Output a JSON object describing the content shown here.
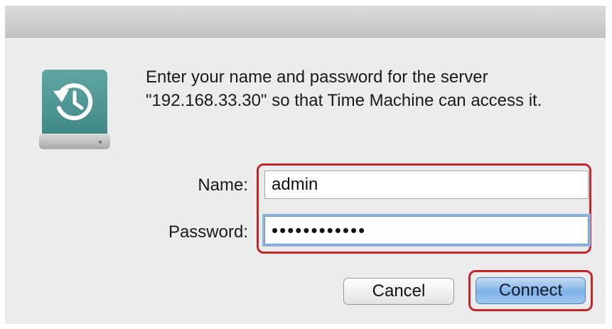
{
  "dialog": {
    "message": "Enter your name and password for the server \"192.168.33.30\" so that Time Machine can access it.",
    "icon": "time-machine-drive-icon"
  },
  "form": {
    "name_label": "Name:",
    "name_value": "admin",
    "password_label": "Password:",
    "password_value": "••••••••••••"
  },
  "buttons": {
    "cancel_label": "Cancel",
    "connect_label": "Connect"
  },
  "colors": {
    "highlight": "#c4262c",
    "default_button": "#7fb2e6",
    "focus_ring": "#8fb3e2"
  }
}
